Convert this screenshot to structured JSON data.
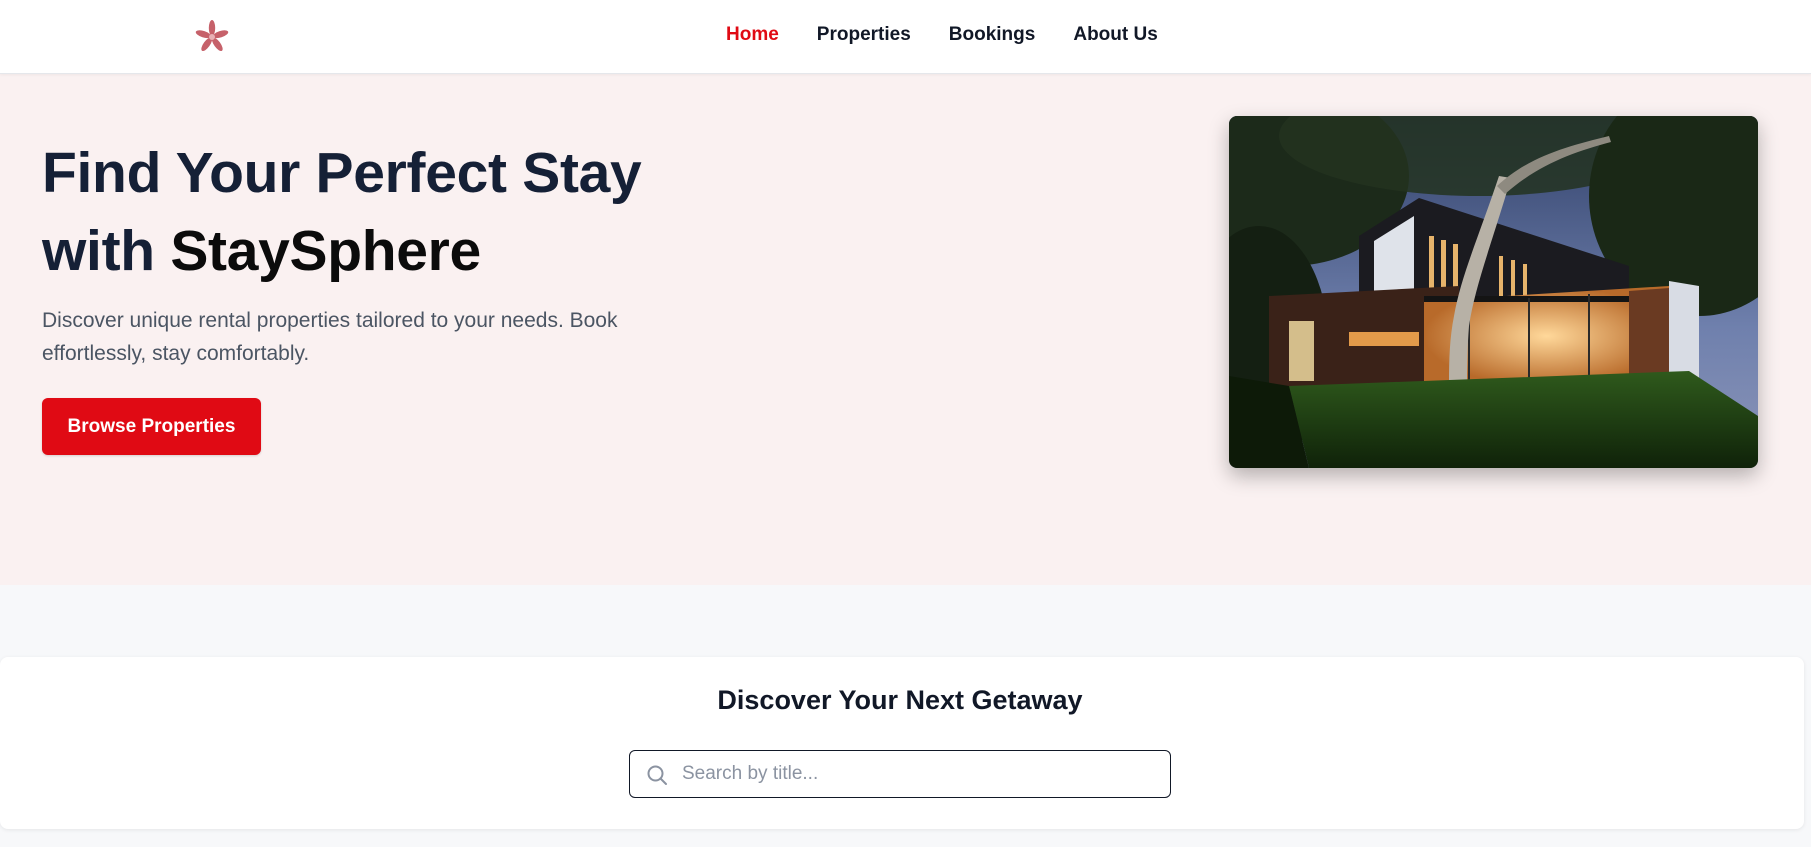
{
  "nav": {
    "logo_icon": "flower-logo-icon",
    "items": [
      {
        "label": "Home",
        "active": true
      },
      {
        "label": "Properties",
        "active": false
      },
      {
        "label": "Bookings",
        "active": false
      },
      {
        "label": "About Us",
        "active": false
      }
    ]
  },
  "hero": {
    "title_line1": "Find Your Perfect Stay",
    "title_line2_prefix": "with ",
    "title_brand": "StaySphere",
    "subtitle": "Discover unique rental properties tailored to your needs. Book effortlessly, stay comfortably.",
    "cta_label": "Browse Properties",
    "image_subject": "modern-house-photo"
  },
  "search": {
    "heading": "Discover Your Next Getaway",
    "placeholder": "Search by title...",
    "value": "",
    "icon": "search-icon"
  },
  "colors": {
    "accent": "#e00a14",
    "hero_bg": "#faf1f1",
    "page_bg": "#f7f8fa",
    "title_text": "#152036"
  }
}
